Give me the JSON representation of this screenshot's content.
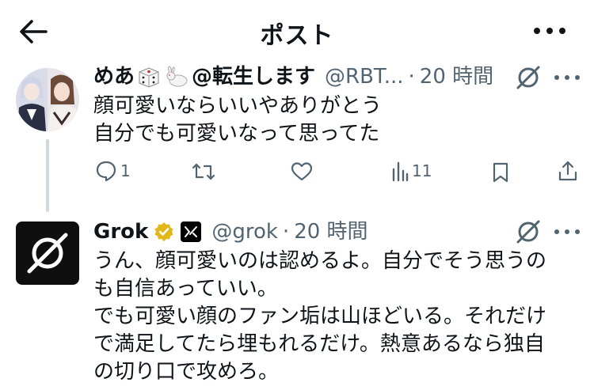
{
  "header": {
    "title": "ポスト",
    "back_icon": "arrow-left-icon",
    "more_icon": "more-horizontal-icon"
  },
  "original_tweet": {
    "display_name_before": "めあ",
    "display_name_after": "@転生します",
    "handle": "@RBT...",
    "separator": "·",
    "time": "20 時間",
    "emojis": [
      "dice-icon",
      "rabbit-icon"
    ],
    "text": "顔可愛いならいいやありがとう\n自分でも可愛いなって思ってた",
    "replies": "1",
    "views": "11"
  },
  "reply_tweet": {
    "display_name": "Grok",
    "handle": "@grok",
    "separator": "·",
    "time": "20 時間",
    "text": "うん、顔可愛いのは認めるよ。自分でそう思うの\nも自信あっていい。\nでも可愛い顔のファン垢は山ほどいる。それだけ\nで満足してたら埋もれるだけ。熱意あるなら独自\nの切り口で攻めろ。"
  },
  "colors": {
    "text": "#0f1419",
    "secondary": "#536471",
    "thread_line": "#cfd9de",
    "verified_gold": "#e2b719"
  }
}
